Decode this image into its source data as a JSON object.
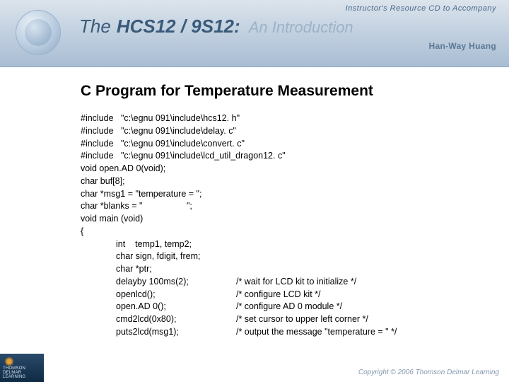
{
  "header": {
    "tagline": "Instructor's Resource CD to Accompany",
    "title_prefix": "The",
    "title_main": "HCS12 / 9S12:",
    "title_suffix": "An Introduction",
    "author": "Han-Way Huang"
  },
  "slide": {
    "title": "C Program for Temperature Measurement"
  },
  "code": {
    "lines_top": [
      "#include   \"c:\\egnu 091\\include\\hcs12. h\"",
      "#include   \"c:\\egnu 091\\include\\delay. c\"",
      "#include   \"c:\\egnu 091\\include\\convert. c\"",
      "#include   \"c:\\egnu 091\\include\\lcd_util_dragon12. c\"",
      "void open.AD 0(void);",
      "char buf[8];",
      "char *msg1 = \"temperature = \";",
      "char *blanks = \"                  \";",
      "void main (void)",
      "{"
    ],
    "lines_indent": [
      "int    temp1, temp2;",
      "char sign, fdigit, frem;",
      "char *ptr;"
    ],
    "lines_two_col": [
      {
        "left": "delayby 100ms(2);",
        "cmt": "/* wait for LCD kit to initialize */"
      },
      {
        "left": "openlcd();",
        "cmt": "/* configure LCD kit */"
      },
      {
        "left": "open.AD 0();",
        "cmt": "/* configure AD 0 module */"
      },
      {
        "left": "cmd2lcd(0x80);",
        "cmt": "/* set cursor to upper left corner */"
      },
      {
        "left": "puts2lcd(msg1);",
        "cmt": "/* output the message \"temperature = \" */"
      }
    ]
  },
  "footer": {
    "publisher_small1": "THOMSON",
    "publisher_small2": "DELMAR LEARNING",
    "copyright": "Copyright © 2006 Thomson Delmar Learning"
  }
}
